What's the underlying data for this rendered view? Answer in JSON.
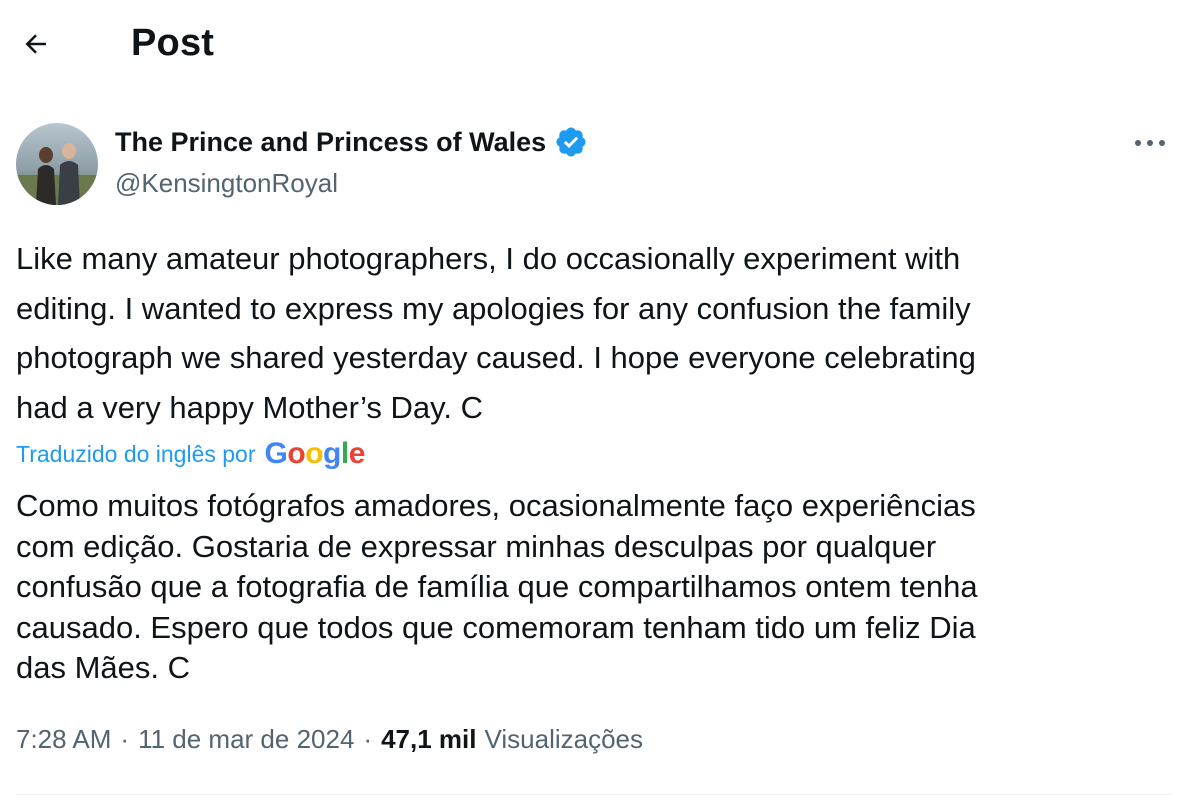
{
  "header": {
    "title": "Post"
  },
  "author": {
    "name": "The Prince and Princess of Wales",
    "handle": "@KensingtonRoyal",
    "verified": true
  },
  "post": {
    "text": "Like many amateur photographers, I do occasionally experiment with\nediting. I wanted to express my apologies for any confusion the family\nphotograph we shared yesterday caused. I hope everyone celebrating\nhad a very happy Mother’s Day. C",
    "translation_label": "Traduzido do inglês por",
    "translation_provider": "Google",
    "translated_text": "Como muitos fotógrafos amadores, ocasionalmente faço experiências\ncom edição. Gostaria de expressar minhas desculpas por qualquer\nconfusão que a fotografia de família que compartilhamos ontem tenha\ncausado. Espero que todos que comemoram tenham tido um feliz Dia\ndas Mães. C"
  },
  "meta": {
    "time": "7:28 AM",
    "separator": "·",
    "date": "11 de mar de 2024",
    "views_count": "47,1 mil",
    "views_label": "Visualizações"
  },
  "icons": {
    "back": "arrow-left-icon",
    "verified": "verified-badge-icon",
    "more": "more-horizontal-icon"
  },
  "colors": {
    "accent": "#1d9bf0",
    "text_primary": "#0f1419",
    "text_secondary": "#536471"
  }
}
